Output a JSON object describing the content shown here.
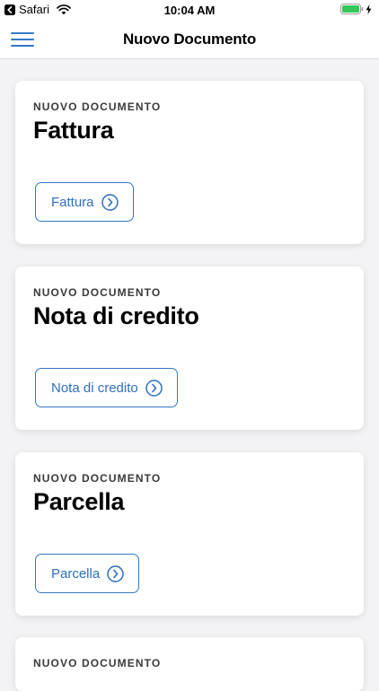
{
  "status_bar": {
    "back_app": "Safari",
    "time": "10:04 AM"
  },
  "nav": {
    "title": "Nuovo Documento"
  },
  "cards": [
    {
      "eyebrow": "NUOVO DOCUMENTO",
      "title": "Fattura",
      "button_label": "Fattura"
    },
    {
      "eyebrow": "NUOVO DOCUMENTO",
      "title": "Nota di credito",
      "button_label": "Nota di credito"
    },
    {
      "eyebrow": "NUOVO DOCUMENTO",
      "title": "Parcella",
      "button_label": "Parcella"
    },
    {
      "eyebrow": "NUOVO DOCUMENTO"
    }
  ],
  "colors": {
    "accent": "#3478c6",
    "battery": "#34c759",
    "background": "#f3f3f5"
  }
}
